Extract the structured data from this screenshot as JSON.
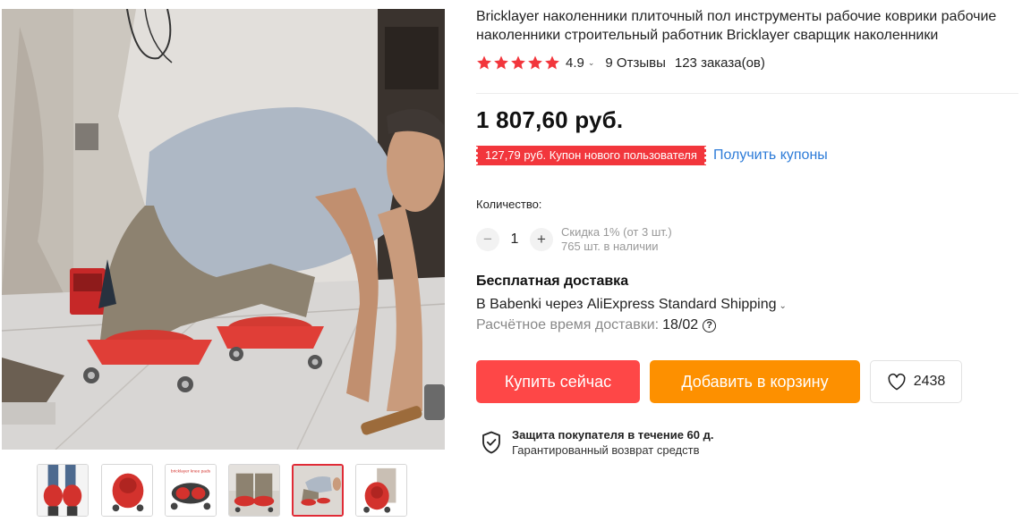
{
  "product": {
    "title": "Bricklayer наколенники плиточный пол инструменты рабочие коврики рабочие наколенники строительный работник Bricklayer сварщик наколенники",
    "rating": "4.9",
    "rating_chevron": "⌄",
    "reviews": "9 Отзывы",
    "orders": "123 заказа(ов)",
    "star_color": "#f2363c",
    "price": "1 807,60 руб."
  },
  "coupon": {
    "badge": "127,79 руб. Купон нового пользователя",
    "link": "Получить купоны",
    "badge_color": "#f2363c",
    "link_color": "#2e7cd8"
  },
  "quantity": {
    "label": "Количество:",
    "minus": "−",
    "value": "1",
    "plus": "+",
    "discount": "Скидка 1% (от 3 шт.)",
    "stock": "765 шт. в наличии"
  },
  "shipping": {
    "title": "Бесплатная доставка",
    "method": "В Babenki через AliExpress Standard Shipping",
    "method_chevron": "⌄",
    "eta_label": "Расчётное время доставки:",
    "eta_value": "18/02",
    "help_icon": "?"
  },
  "actions": {
    "buy_now": "Купить сейчас",
    "add_to_cart": "Добавить в корзину",
    "wishlist_count": "2438",
    "buy_color": "#fe4747",
    "cart_color": "#fd9000"
  },
  "protection": {
    "title": "Защита покупателя в течение 60 д.",
    "subtitle": "Гарантированный возврат средств",
    "icon": "shield-check-icon"
  },
  "gallery": {
    "thumb3_caption": "bricklayer knee pads",
    "thumbnails": [
      "thumb-knee-pads-worn",
      "thumb-single-pad",
      "thumb-pads-on-tool",
      "thumb-worker-closeup",
      "thumb-worker-kneeling",
      "thumb-pad-front"
    ],
    "active_index": 4
  }
}
